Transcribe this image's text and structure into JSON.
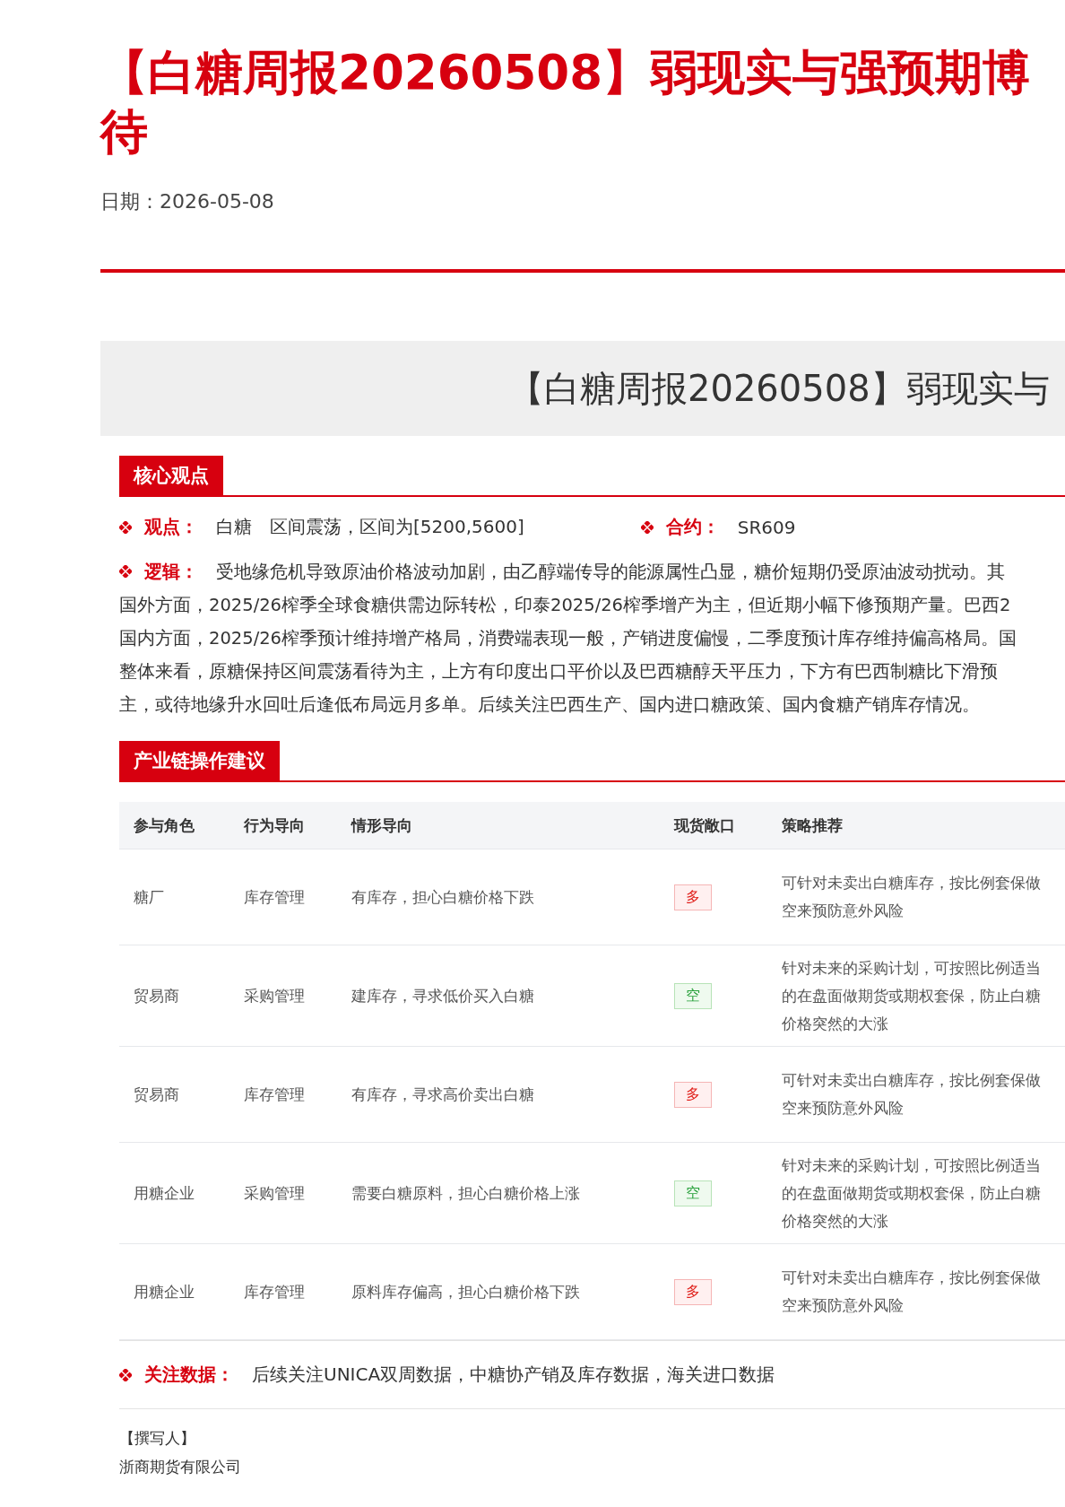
{
  "title_lines": [
    "【白糖周报20260508】弱现实与强预期博",
    "待"
  ],
  "date": "日期：2026-05-08",
  "banner": "【白糖周报20260508】弱现实与",
  "core": {
    "heading": "核心观点",
    "view": {
      "label": "观点：",
      "value": "白糖　区间震荡，区间为[5200,5600]"
    },
    "contract": {
      "label": "合约：",
      "value": "SR609"
    },
    "logic": {
      "label": "逻辑：",
      "lines": [
        "受地缘危机导致原油价格波动加剧，由乙醇端传导的能源属性凸显，糖价短期仍受原油波动扰动。其",
        "国外方面，2025/26榨季全球食糖供需边际转松，印泰2025/26榨季增产为主，但近期小幅下修预期产量。巴西2",
        "国内方面，2025/26榨季预计维持增产格局，消费端表现一般，产销进度偏慢，二季度预计库存维持偏高格局。国",
        "整体来看，原糖保持区间震荡看待为主，上方有印度出口平价以及巴西糖醇天平压力，下方有巴西制糖比下滑预",
        "主，或待地缘升水回吐后逢低布局远月多单。后续关注巴西生产、国内进口糖政策、国内食糖产销库存情况。"
      ]
    }
  },
  "chain": {
    "heading": "产业链操作建议",
    "columns": [
      "参与角色",
      "行为导向",
      "情形导向",
      "现货敞口",
      "策略推荐"
    ],
    "rows": [
      {
        "role": "糖厂",
        "behavior": "库存管理",
        "situation": "有库存，担心白糖价格下跌",
        "exposure": {
          "label": "多",
          "kind": "long"
        },
        "strategy": [
          "可针对未卖出白糖库存，按比例套保做",
          "空来预防意外风险"
        ]
      },
      {
        "role": "贸易商",
        "behavior": "采购管理",
        "situation": "建库存，寻求低价买入白糖",
        "exposure": {
          "label": "空",
          "kind": "short"
        },
        "strategy": [
          "针对未来的采购计划，可按照比例适当",
          "的在盘面做期货或期权套保，防止白糖",
          "价格突然的大涨"
        ]
      },
      {
        "role": "贸易商",
        "behavior": "库存管理",
        "situation": "有库存，寻求高价卖出白糖",
        "exposure": {
          "label": "多",
          "kind": "long"
        },
        "strategy": [
          "可针对未卖出白糖库存，按比例套保做",
          "空来预防意外风险"
        ]
      },
      {
        "role": "用糖企业",
        "behavior": "采购管理",
        "situation": "需要白糖原料，担心白糖价格上涨",
        "exposure": {
          "label": "空",
          "kind": "short"
        },
        "strategy": [
          "针对未来的采购计划，可按照比例适当",
          "的在盘面做期货或期权套保，防止白糖",
          "价格突然的大涨"
        ]
      },
      {
        "role": "用糖企业",
        "behavior": "库存管理",
        "situation": "原料库存偏高，担心白糖价格下跌",
        "exposure": {
          "label": "多",
          "kind": "long"
        },
        "strategy": [
          "可针对未卖出白糖库存，按比例套保做",
          "空来预防意外风险"
        ]
      }
    ]
  },
  "focus": {
    "label": "关注数据：",
    "value": "后续关注UNICA双周数据，中糖协产销及库存数据，海关进口数据"
  },
  "author": {
    "heading": "【撰写人】",
    "company": "浙商期货有限公司"
  }
}
